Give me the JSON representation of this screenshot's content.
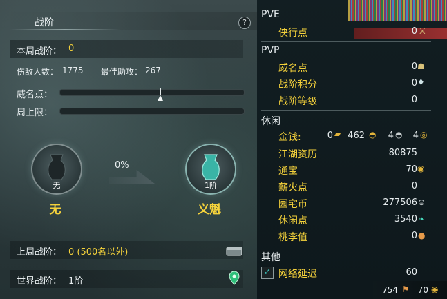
{
  "left": {
    "title": "战阶",
    "help_label": "?",
    "weekly_label": "本周战阶：",
    "weekly_value": "0",
    "kills_label": "伤敌人数：",
    "kills_value": "1775",
    "assists_label": "最佳助攻：",
    "assists_value": "267",
    "prestige_label": "威名点：",
    "weekly_cap_label": "周上限：",
    "progress_pct": "0%",
    "current_rank_level": "无",
    "current_rank_name": "无",
    "next_rank_level": "1阶",
    "next_rank_name": "义魁",
    "last_week_label": "上周战阶：",
    "last_week_value": "0 (500名以外)",
    "world_label": "世界战阶：",
    "world_value": "1阶",
    "prestige_marker_fraction": 0.55
  },
  "right": {
    "pve": {
      "section": "PVE",
      "items": [
        {
          "label": "侠行点",
          "value": "0",
          "icon": "sword-icon"
        }
      ]
    },
    "pvp": {
      "section": "PVP",
      "items": [
        {
          "label": "威名点",
          "value": "0",
          "icon": "mask-icon"
        },
        {
          "label": "战阶积分",
          "value": "0",
          "icon": "crystal-icon"
        },
        {
          "label": "战阶等级",
          "value": "0",
          "icon": ""
        }
      ]
    },
    "leisure": {
      "section": "休闲",
      "money_label": "金钱:",
      "money_gold": "0",
      "money_silver": "462",
      "money_copper": "4",
      "money_coin": "4",
      "items": [
        {
          "label": "江湖资历",
          "value": "80875",
          "icon": ""
        },
        {
          "label": "通宝",
          "value": "70",
          "icon": "coin-icon"
        },
        {
          "label": "薪火点",
          "value": "0",
          "icon": ""
        },
        {
          "label": "园宅币",
          "value": "277506",
          "icon": "house-coin-icon"
        },
        {
          "label": "休闲点",
          "value": "3540",
          "icon": "leaf-icon"
        },
        {
          "label": "桃李值",
          "value": "0",
          "icon": "peach-icon"
        }
      ]
    },
    "other": {
      "section": "其他",
      "latency_label": "网络延迟",
      "latency_value": "60",
      "latency_checked": true
    },
    "bottom": {
      "value_a": "754",
      "value_b": "70"
    }
  },
  "colors": {
    "accent_yellow": "#f5d23b",
    "panel_bg": "#2c3a3c"
  }
}
